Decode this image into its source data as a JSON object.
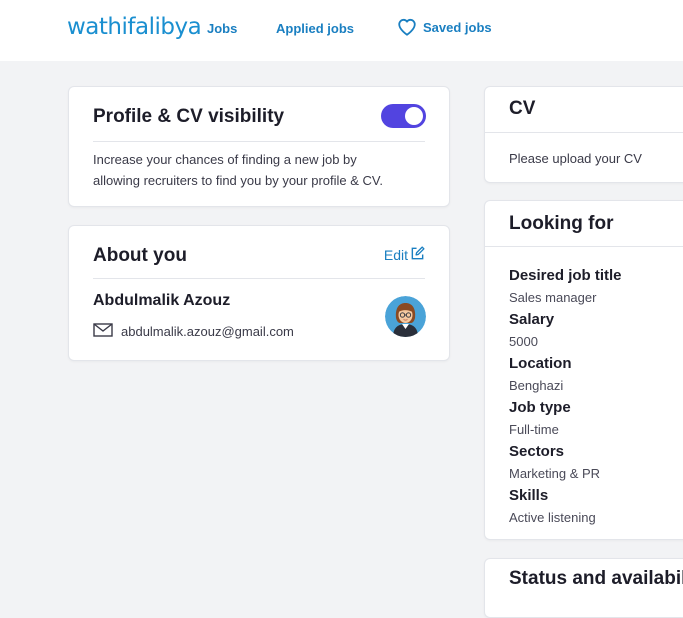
{
  "header": {
    "logo": "wathifalibya",
    "nav": {
      "jobs": "Jobs",
      "applied_jobs": "Applied jobs",
      "saved_jobs": "Saved jobs"
    }
  },
  "visibility_card": {
    "title": "Profile & CV visibility",
    "toggle_on": true,
    "description": "Increase your chances of finding a new job by allowing recruiters to find you by your profile & CV."
  },
  "about_card": {
    "title": "About you",
    "edit_label": "Edit",
    "name": "Abdulmalik Azouz",
    "email": "abdulmalik.azouz@gmail.com"
  },
  "cv_card": {
    "title": "CV",
    "message": "Please upload your CV"
  },
  "looking_for_card": {
    "title": "Looking for",
    "fields": [
      {
        "label": "Desired job title",
        "value": "Sales manager"
      },
      {
        "label": "Salary",
        "value": "5000"
      },
      {
        "label": "Location",
        "value": "Benghazi"
      },
      {
        "label": "Job type",
        "value": "Full-time"
      },
      {
        "label": "Sectors",
        "value": "Marketing & PR"
      },
      {
        "label": "Skills",
        "value": "Active listening"
      }
    ]
  },
  "status_card": {
    "title": "Status and availabili"
  },
  "colors": {
    "brand": "#1a8fd0",
    "link": "#1a7fc1",
    "toggle": "#5244e0",
    "background": "#f2f3f5"
  },
  "icons": {
    "saved": "heart-icon",
    "edit": "edit-icon",
    "email": "envelope-icon",
    "avatar": "user-avatar"
  }
}
